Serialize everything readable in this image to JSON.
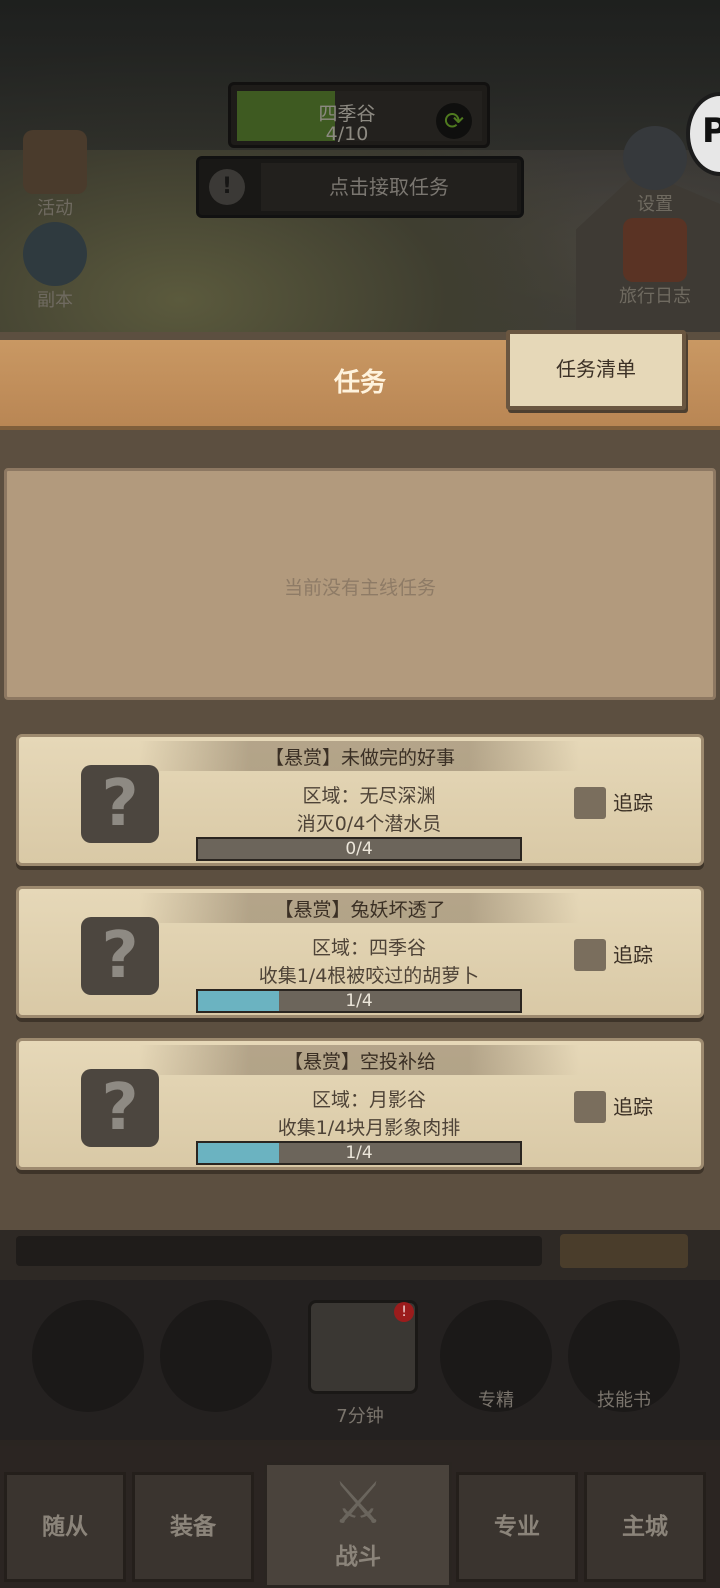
{
  "hud": {
    "zone_name": "四季谷",
    "zone_progress": "4/10",
    "zone_progress_fraction": 0.4,
    "accept_task": "点击接取任务",
    "activity_label": "活动",
    "dungeon_label": "副本",
    "settings_label": "设置",
    "journal_label": "旅行日志"
  },
  "panel": {
    "title": "任务",
    "list_tab": "任务清单",
    "main_empty": "当前没有主线任务"
  },
  "quests": [
    {
      "title": "【悬赏】未做完的好事",
      "region": "区域：无尽深渊",
      "objective": "消灭0/4个潜水员",
      "progress_text": "0/4",
      "progress": 0.0,
      "track_label": "追踪"
    },
    {
      "title": "【悬赏】兔妖坏透了",
      "region": "区域：四季谷",
      "objective": "收集1/4根被咬过的胡萝卜",
      "progress_text": "1/4",
      "progress": 0.25,
      "track_label": "追踪"
    },
    {
      "title": "【悬赏】空投补给",
      "region": "区域：月影谷",
      "objective": "收集1/4块月影象肉排",
      "progress_text": "1/4",
      "progress": 0.25,
      "track_label": "追踪"
    }
  ],
  "actions": {
    "chest_timer": "7分钟",
    "specialty": "专精",
    "skill_book": "技能书",
    "badge": "!"
  },
  "nav": {
    "followers": "随从",
    "equipment": "装备",
    "battle": "战斗",
    "profession": "专业",
    "main_city": "主城"
  },
  "colors": {
    "progress_fill": "#6bb3c1",
    "zone_fill": "#3e5a21",
    "header": "#c99863"
  }
}
